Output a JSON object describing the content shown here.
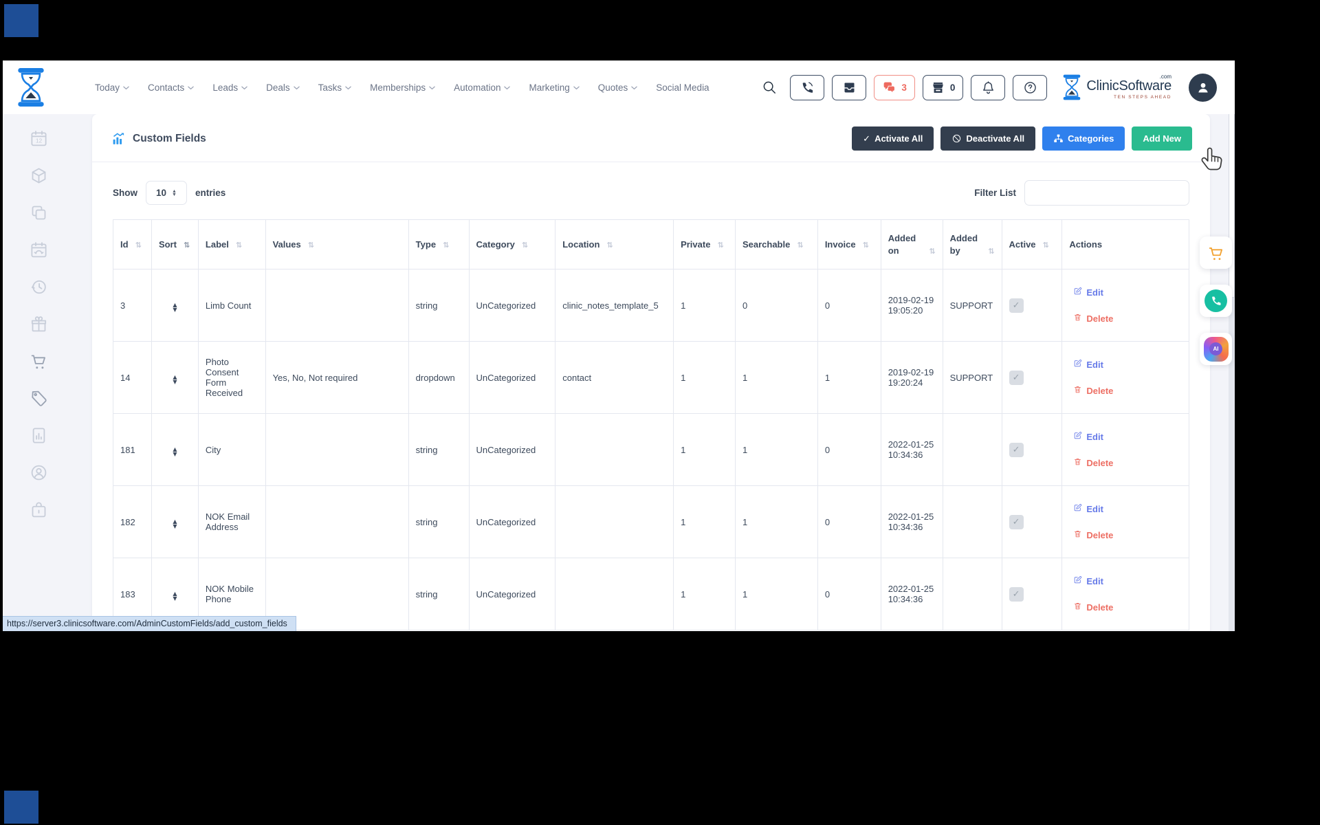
{
  "topnav": {
    "items": [
      {
        "label": "Today",
        "caret": true
      },
      {
        "label": "Contacts",
        "caret": true
      },
      {
        "label": "Leads",
        "caret": true
      },
      {
        "label": "Deals",
        "caret": true
      },
      {
        "label": "Tasks",
        "caret": true
      },
      {
        "label": "Memberships",
        "caret": true
      },
      {
        "label": "Automation",
        "caret": true
      },
      {
        "label": "Marketing",
        "caret": true
      },
      {
        "label": "Quotes",
        "caret": true
      },
      {
        "label": "Social Media",
        "caret": false
      }
    ],
    "icon_buttons": [
      {
        "name": "phone",
        "badge": null,
        "style": "normal"
      },
      {
        "name": "inbox",
        "badge": null,
        "style": "normal"
      },
      {
        "name": "chat",
        "badge": "3",
        "style": "alert"
      },
      {
        "name": "store",
        "badge": "0",
        "style": "normal"
      },
      {
        "name": "bell",
        "badge": null,
        "style": "normal"
      },
      {
        "name": "help",
        "badge": null,
        "style": "normal"
      }
    ],
    "logo": {
      "text": "ClinicSoftware",
      "suffix": ".com",
      "tagline": "TEN STEPS AHEAD"
    }
  },
  "sidebar": {
    "icons": [
      "calendar",
      "package",
      "copy",
      "calendar-sync",
      "history",
      "gift",
      "cart",
      "tag",
      "report",
      "user-circle",
      "case"
    ]
  },
  "page": {
    "title": "Custom Fields",
    "actions": [
      {
        "label": "Activate All",
        "icon": "check",
        "style": "dark"
      },
      {
        "label": "Deactivate All",
        "icon": "ban",
        "style": "dark"
      },
      {
        "label": "Categories",
        "icon": "sitemap",
        "style": "blue"
      },
      {
        "label": "Add New",
        "icon": null,
        "style": "green"
      }
    ]
  },
  "controls": {
    "show": "Show",
    "entries": "entries",
    "page_size": "10",
    "filter_label": "Filter List",
    "filter_value": ""
  },
  "table": {
    "columns": [
      {
        "label": "Id",
        "sortable": true
      },
      {
        "label": "Sort",
        "sortable": true,
        "sorted": true
      },
      {
        "label": "Label",
        "sortable": true
      },
      {
        "label": "Values",
        "sortable": true
      },
      {
        "label": "Type",
        "sortable": true
      },
      {
        "label": "Category",
        "sortable": true
      },
      {
        "label": "Location",
        "sortable": true
      },
      {
        "label": "Private",
        "sortable": true
      },
      {
        "label": "Searchable",
        "sortable": true
      },
      {
        "label": "Invoice",
        "sortable": true
      },
      {
        "label": "Added on",
        "sortable": true
      },
      {
        "label": "Added by",
        "sortable": true
      },
      {
        "label": "Active",
        "sortable": true
      },
      {
        "label": "Actions",
        "sortable": false
      }
    ],
    "rows": [
      {
        "id": "3",
        "label": "Limb Count",
        "values": "",
        "type": "string",
        "category": "UnCategorized",
        "location": "clinic_notes_template_5",
        "private": "1",
        "searchable": "0",
        "invoice": "0",
        "added_on": "2019-02-19 19:05:20",
        "added_by": "SUPPORT",
        "active": true
      },
      {
        "id": "14",
        "label": "Photo Consent Form Received",
        "values": "Yes, No, Not required",
        "type": "dropdown",
        "category": "UnCategorized",
        "location": "contact",
        "private": "1",
        "searchable": "1",
        "invoice": "1",
        "added_on": "2019-02-19 19:20:24",
        "added_by": "SUPPORT",
        "active": true
      },
      {
        "id": "181",
        "label": "City",
        "values": "",
        "type": "string",
        "category": "UnCategorized",
        "location": "",
        "private": "1",
        "searchable": "1",
        "invoice": "0",
        "added_on": "2022-01-25 10:34:36",
        "added_by": "",
        "active": true
      },
      {
        "id": "182",
        "label": "NOK Email Address",
        "values": "",
        "type": "string",
        "category": "UnCategorized",
        "location": "",
        "private": "1",
        "searchable": "1",
        "invoice": "0",
        "added_on": "2022-01-25 10:34:36",
        "added_by": "",
        "active": true
      },
      {
        "id": "183",
        "label": "NOK Mobile Phone",
        "values": "",
        "type": "string",
        "category": "UnCategorized",
        "location": "",
        "private": "1",
        "searchable": "1",
        "invoice": "0",
        "added_on": "2022-01-25 10:34:36",
        "added_by": "",
        "active": true
      }
    ],
    "row_actions": {
      "edit": "Edit",
      "delete": "Delete"
    }
  },
  "status_url": "https://server3.clinicsoftware.com/AdminCustomFields/add_custom_fields",
  "colors": {
    "accent_blue": "#2f80ed",
    "accent_green": "#2abb8f",
    "dark_button": "#333e4e",
    "alert_red": "#ee6a5f",
    "link_edit": "#6579e8",
    "link_delete": "#ed6f64",
    "logo_blue": "#1b7fe4"
  }
}
